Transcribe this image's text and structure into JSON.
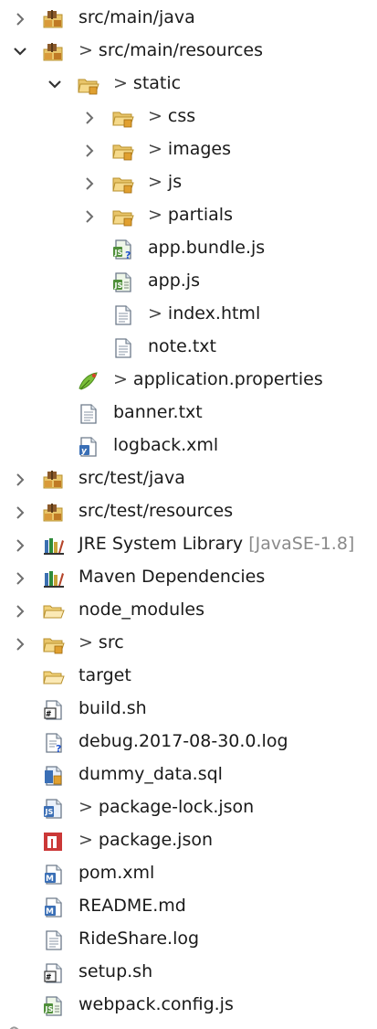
{
  "tree": {
    "rows": [
      {
        "depth": 0,
        "chevron": "right",
        "icon": "package-folder-icon",
        "dirty": false,
        "label": "src/main/java",
        "decoration": ""
      },
      {
        "depth": 0,
        "chevron": "down",
        "icon": "package-folder-icon",
        "dirty": true,
        "label": "src/main/resources",
        "decoration": ""
      },
      {
        "depth": 1,
        "chevron": "down",
        "icon": "folder-icon",
        "dirty": true,
        "label": "static",
        "decoration": ""
      },
      {
        "depth": 2,
        "chevron": "right",
        "icon": "folder-icon",
        "dirty": true,
        "label": "css",
        "decoration": ""
      },
      {
        "depth": 2,
        "chevron": "right",
        "icon": "folder-icon",
        "dirty": true,
        "label": "images",
        "decoration": ""
      },
      {
        "depth": 2,
        "chevron": "right",
        "icon": "folder-icon",
        "dirty": true,
        "label": "js",
        "decoration": ""
      },
      {
        "depth": 2,
        "chevron": "right",
        "icon": "folder-icon",
        "dirty": true,
        "label": "partials",
        "decoration": ""
      },
      {
        "depth": 2,
        "chevron": "none",
        "icon": "js-file-unknown-icon",
        "dirty": false,
        "label": "app.bundle.js",
        "decoration": ""
      },
      {
        "depth": 2,
        "chevron": "none",
        "icon": "js-file-icon",
        "dirty": false,
        "label": "app.js",
        "decoration": ""
      },
      {
        "depth": 2,
        "chevron": "none",
        "icon": "text-file-icon",
        "dirty": true,
        "label": "index.html",
        "decoration": ""
      },
      {
        "depth": 2,
        "chevron": "none",
        "icon": "text-file-icon",
        "dirty": false,
        "label": "note.txt",
        "decoration": ""
      },
      {
        "depth": 1,
        "chevron": "none",
        "icon": "properties-file-icon",
        "dirty": true,
        "label": "application.properties",
        "decoration": ""
      },
      {
        "depth": 1,
        "chevron": "none",
        "icon": "text-file-icon",
        "dirty": false,
        "label": "banner.txt",
        "decoration": ""
      },
      {
        "depth": 1,
        "chevron": "none",
        "icon": "xml-file-icon",
        "dirty": false,
        "label": "logback.xml",
        "decoration": ""
      },
      {
        "depth": 0,
        "chevron": "right",
        "icon": "package-folder-icon",
        "dirty": false,
        "label": "src/test/java",
        "decoration": ""
      },
      {
        "depth": 0,
        "chevron": "right",
        "icon": "package-folder-icon",
        "dirty": false,
        "label": "src/test/resources",
        "decoration": ""
      },
      {
        "depth": 0,
        "chevron": "right",
        "icon": "library-icon",
        "dirty": false,
        "label": "JRE System Library",
        "decoration": "[JavaSE-1.8]"
      },
      {
        "depth": 0,
        "chevron": "right",
        "icon": "library-icon",
        "dirty": false,
        "label": "Maven Dependencies",
        "decoration": ""
      },
      {
        "depth": 0,
        "chevron": "right",
        "icon": "open-folder-icon",
        "dirty": false,
        "label": "node_modules",
        "decoration": ""
      },
      {
        "depth": 0,
        "chevron": "right",
        "icon": "folder-icon",
        "dirty": true,
        "label": "src",
        "decoration": ""
      },
      {
        "depth": 0,
        "chevron": "none",
        "icon": "open-folder-icon",
        "dirty": false,
        "label": "target",
        "decoration": ""
      },
      {
        "depth": 0,
        "chevron": "none",
        "icon": "shell-script-icon",
        "dirty": false,
        "label": "build.sh",
        "decoration": ""
      },
      {
        "depth": 0,
        "chevron": "none",
        "icon": "log-file-unknown-icon",
        "dirty": false,
        "label": "debug.2017-08-30.0.log",
        "decoration": ""
      },
      {
        "depth": 0,
        "chevron": "none",
        "icon": "sql-file-icon",
        "dirty": false,
        "label": "dummy_data.sql",
        "decoration": ""
      },
      {
        "depth": 0,
        "chevron": "none",
        "icon": "json-file-icon",
        "dirty": true,
        "label": "package-lock.json",
        "decoration": ""
      },
      {
        "depth": 0,
        "chevron": "none",
        "icon": "npm-file-icon",
        "dirty": true,
        "label": "package.json",
        "decoration": ""
      },
      {
        "depth": 0,
        "chevron": "none",
        "icon": "maven-pom-icon",
        "dirty": false,
        "label": "pom.xml",
        "decoration": ""
      },
      {
        "depth": 0,
        "chevron": "none",
        "icon": "markdown-file-icon",
        "dirty": false,
        "label": "README.md",
        "decoration": ""
      },
      {
        "depth": 0,
        "chevron": "none",
        "icon": "text-file-icon",
        "dirty": false,
        "label": "RideShare.log",
        "decoration": ""
      },
      {
        "depth": 0,
        "chevron": "none",
        "icon": "shell-script-icon",
        "dirty": false,
        "label": "setup.sh",
        "decoration": ""
      },
      {
        "depth": 0,
        "chevron": "none",
        "icon": "js-file-icon",
        "dirty": false,
        "label": "webpack.config.js",
        "decoration": ""
      }
    ],
    "dirty_marker": ">",
    "colors": {
      "chevron": "#6e6e6e",
      "text": "#1a1a1a",
      "decoration": "#8a8a8a",
      "folder": "#e8c56a",
      "folder_dark": "#b8902c",
      "package_brown": "#8b5a2b",
      "jar_green": "#2e8b3a",
      "js_green": "#4f8f3a",
      "npm_red": "#cb3837",
      "json_blue": "#3b6fb6"
    }
  }
}
